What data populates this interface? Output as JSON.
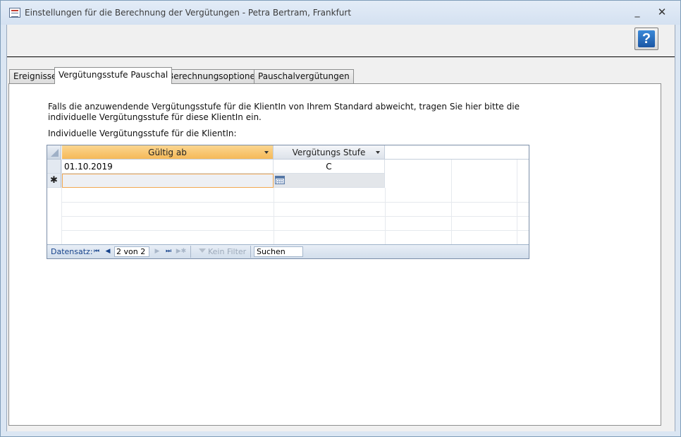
{
  "window": {
    "title": "Einstellungen für die Berechnung der Vergütungen - Petra Bertram, Frankfurt",
    "minimize": "_",
    "close": "✕"
  },
  "help_button": {
    "label": "?",
    "icon": "help-icon"
  },
  "tabs": [
    {
      "label": "Ereignisse",
      "active": false
    },
    {
      "label": "Vergütungsstufe Pauschal",
      "active": true
    },
    {
      "label": "Berechnungsoptionen",
      "active": false
    },
    {
      "label": "Pauschalvergütungen",
      "active": false
    }
  ],
  "panel": {
    "info_text": "Falls die anzuwendende Vergütungsstufe für die KlientIn von Ihrem Standard abweicht, tragen Sie hier bitte die individuelle Vergütungsstufe für diese KlientIn ein.",
    "sub_label": "Individuelle Vergütungsstufe für die KlientIn:"
  },
  "grid": {
    "columns": [
      "Gültig ab",
      "Vergütungs Stufe"
    ],
    "rows": [
      {
        "gueltig_ab": "01.10.2019",
        "stufe": "C"
      }
    ],
    "new_row_marker": "✱"
  },
  "navigation": {
    "label": "Datensatz:",
    "first": "⏮",
    "prev": "◀",
    "position": "2 von 2",
    "next": "▶",
    "last": "⏭",
    "new": "▶✱",
    "filter": "Kein Filter",
    "search": "Suchen"
  }
}
